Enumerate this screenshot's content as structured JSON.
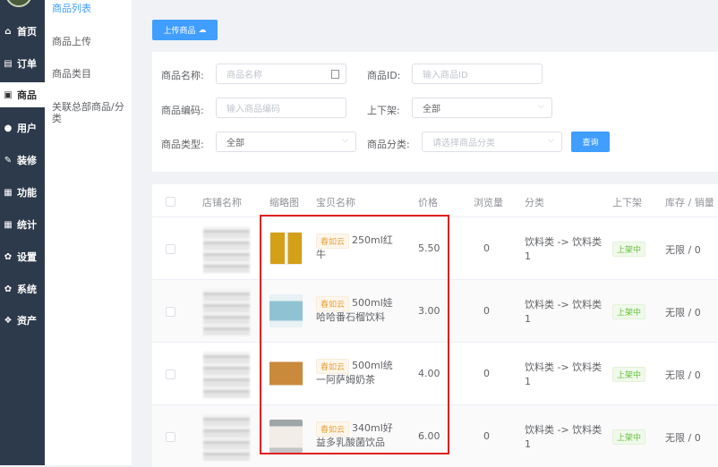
{
  "sidebar": {
    "items": [
      {
        "icon": "home-icon",
        "glyph": "⌂",
        "label": "首页"
      },
      {
        "icon": "order-icon",
        "glyph": "▤",
        "label": "订单"
      },
      {
        "icon": "bag-icon",
        "glyph": "▣",
        "label": "商品"
      },
      {
        "icon": "user-icon",
        "glyph": "●",
        "label": "用户"
      },
      {
        "icon": "decor-icon",
        "glyph": "✎",
        "label": "装修"
      },
      {
        "icon": "grid-icon",
        "glyph": "▦",
        "label": "功能"
      },
      {
        "icon": "stats-icon",
        "glyph": "▦",
        "label": "统计"
      },
      {
        "icon": "gear-icon",
        "glyph": "✿",
        "label": "设置"
      },
      {
        "icon": "system-icon",
        "glyph": "✿",
        "label": "系统"
      },
      {
        "icon": "asset-icon",
        "glyph": "❖",
        "label": "资产"
      }
    ]
  },
  "subnav": {
    "items": [
      "商品列表",
      "商品上传",
      "商品类目",
      "关联总部商品/分类"
    ]
  },
  "toolbar": {
    "upload_label": "上传商品",
    "upload_icon": "☁"
  },
  "filters": {
    "name_label": "商品名称:",
    "name_placeholder": "商品名称",
    "id_label": "商品ID:",
    "id_placeholder": "输入商品ID",
    "code_label": "商品编码:",
    "code_placeholder": "输入商品编码",
    "shelf_label": "上下架:",
    "shelf_value": "全部",
    "type_label": "商品类型:",
    "type_value": "全部",
    "category_label": "商品分类:",
    "category_placeholder": "请选择商品分类",
    "search_label": "查询"
  },
  "table": {
    "headers": [
      "店铺名称",
      "缩略图",
      "宝贝名称",
      "价格",
      "浏览量",
      "分类",
      "上下架",
      "库存 / 销量"
    ],
    "rows": [
      {
        "tag": "春如云",
        "name": "250ml红牛",
        "price": "5.50",
        "views": "0",
        "category": "饮料类 -> 饮料类1",
        "status": "上架中",
        "stock": "无限 / 0"
      },
      {
        "tag": "春如云",
        "name": "500ml娃哈哈番石榴饮料",
        "price": "3.00",
        "views": "0",
        "category": "饮料类 -> 饮料类1",
        "status": "上架中",
        "stock": "无限 / 0"
      },
      {
        "tag": "春如云",
        "name": "500ml统一阿萨姆奶茶",
        "price": "4.00",
        "views": "0",
        "category": "饮料类 -> 饮料类1",
        "status": "上架中",
        "stock": "无限 / 0"
      },
      {
        "tag": "春如云",
        "name": "340ml好益多乳酸菌饮品",
        "price": "6.00",
        "views": "0",
        "category": "饮料类 -> 饮料类1",
        "status": "上架中",
        "stock": "无限 / 0"
      }
    ]
  },
  "colors": {
    "primary": "#409eff",
    "sidebar": "#2d3a4b",
    "highlight": "#e02020",
    "tag": "#e6a23c",
    "success": "#67c23a"
  }
}
